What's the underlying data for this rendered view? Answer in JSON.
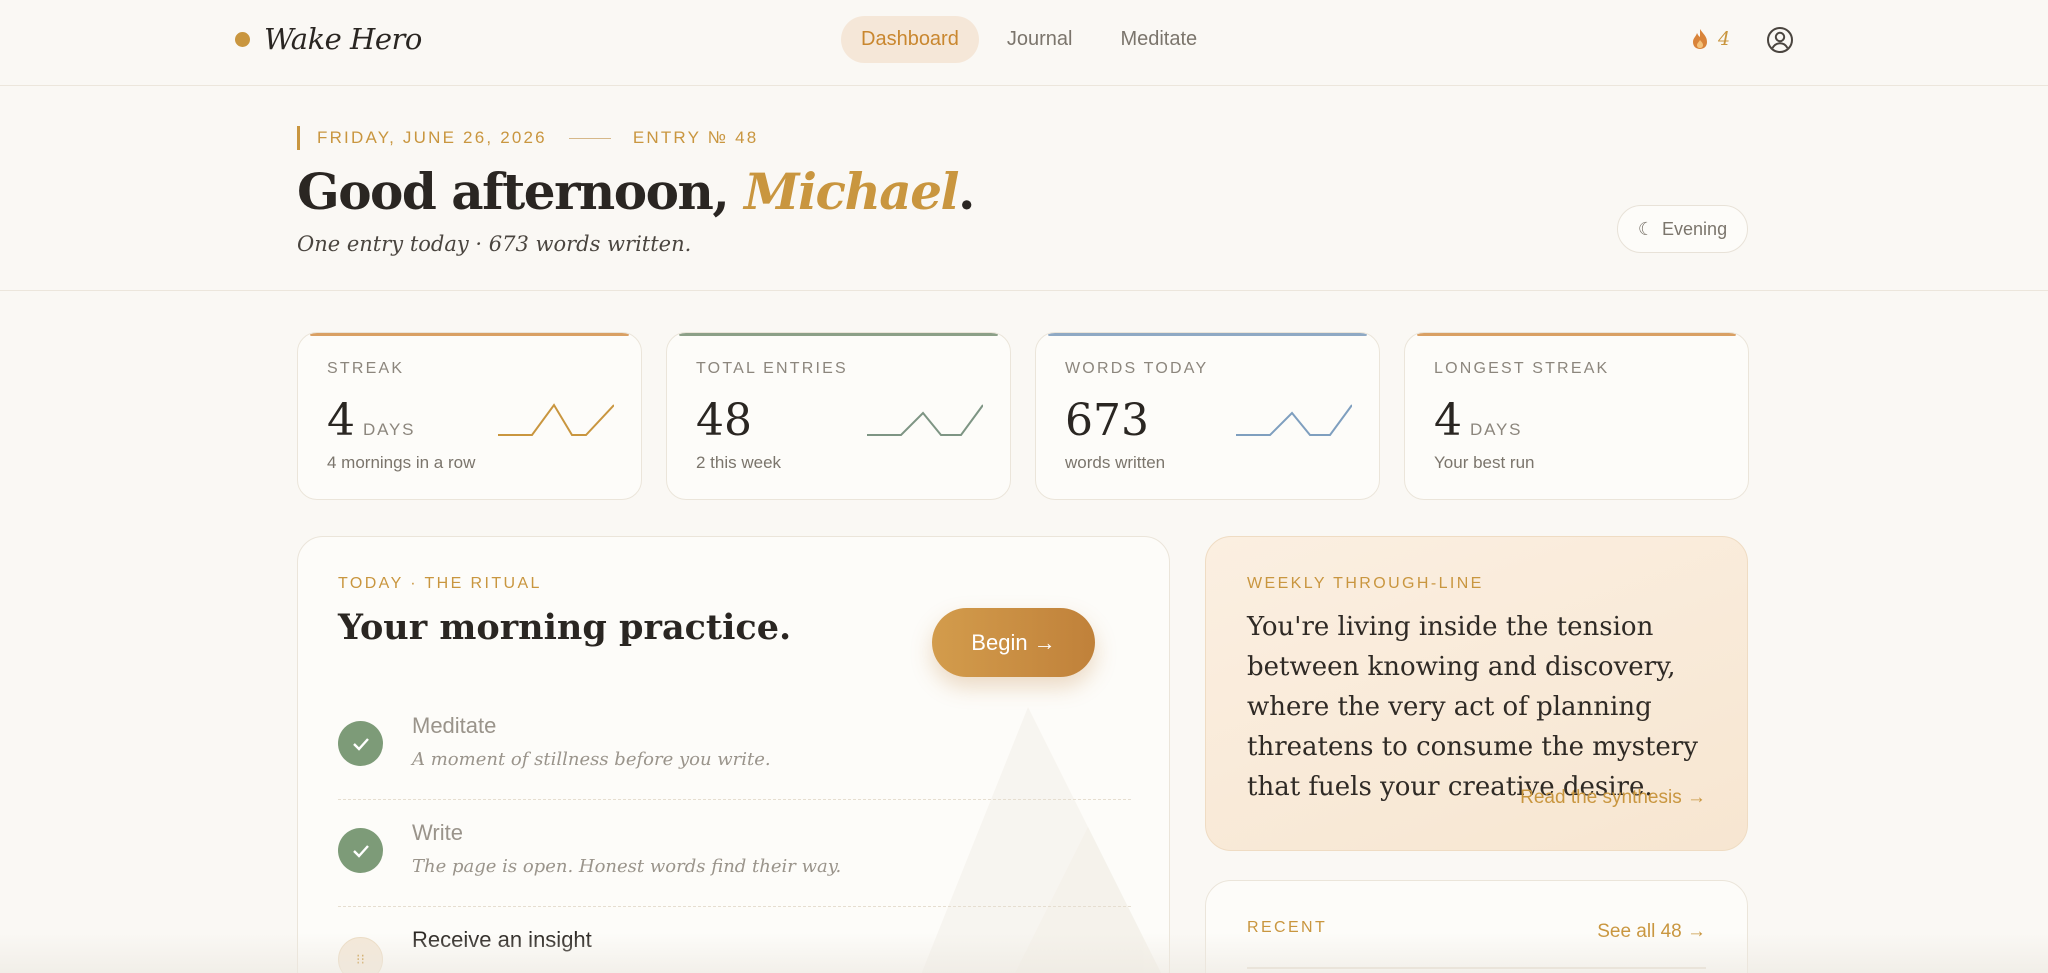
{
  "brand": {
    "name": "Wake Hero"
  },
  "nav": {
    "items": [
      {
        "label": "Dashboard",
        "active": true
      },
      {
        "label": "Journal",
        "active": false
      },
      {
        "label": "Meditate",
        "active": false
      }
    ],
    "streak_count": "4",
    "streak_icon": "flame-icon",
    "profile_icon": "user-circle-icon"
  },
  "hero": {
    "date": "FRIDAY, JUNE 26, 2026",
    "entry": "ENTRY № 48",
    "greeting_prefix": "Good afternoon, ",
    "greeting_name": "Michael",
    "greeting_suffix": ".",
    "subline": "One entry today · 673 words written.",
    "mode_icon": "☾",
    "mode_label": "Evening"
  },
  "stats": [
    {
      "label": "STREAK",
      "value": "4",
      "unit": "DAYS",
      "sub": "4 mornings in a row",
      "accent": "#d9a064",
      "spark": true,
      "spark_color": "#c9963f"
    },
    {
      "label": "TOTAL ENTRIES",
      "value": "48",
      "unit": "",
      "sub": "2 this week",
      "accent": "#8ca088",
      "spark": true,
      "spark_color": "#7e9584"
    },
    {
      "label": "WORDS TODAY",
      "value": "673",
      "unit": "",
      "sub": "words written",
      "accent": "#8fa9c4",
      "spark": true,
      "spark_color": "#7f9fbf"
    },
    {
      "label": "LONGEST STREAK",
      "value": "4",
      "unit": "DAYS",
      "sub": "Your best run",
      "accent": "#d9a064",
      "spark": false,
      "spark_color": ""
    }
  ],
  "ritual": {
    "eyebrow": "TODAY · THE RITUAL",
    "title": "Your morning practice.",
    "begin_label": "Begin →",
    "steps": [
      {
        "title": "Meditate",
        "desc": "A moment of stillness before you write.",
        "done": true
      },
      {
        "title": "Write",
        "desc": "The page is open. Honest words find their way.",
        "done": true
      },
      {
        "title": "Receive an insight",
        "desc": "",
        "done": false
      }
    ]
  },
  "synthesis": {
    "eyebrow": "WEEKLY THROUGH-LINE",
    "quote": "You're living inside the tension between knowing and discovery, where the very act of planning threatens to consume the mystery that fuels your creative desire.",
    "link": "Read the synthesis →"
  },
  "recent": {
    "eyebrow": "RECENT",
    "link": "See all 48 →"
  },
  "colors": {
    "accent": "#c9963f",
    "background": "#faf8f4",
    "done_green": "#7d9b78"
  }
}
